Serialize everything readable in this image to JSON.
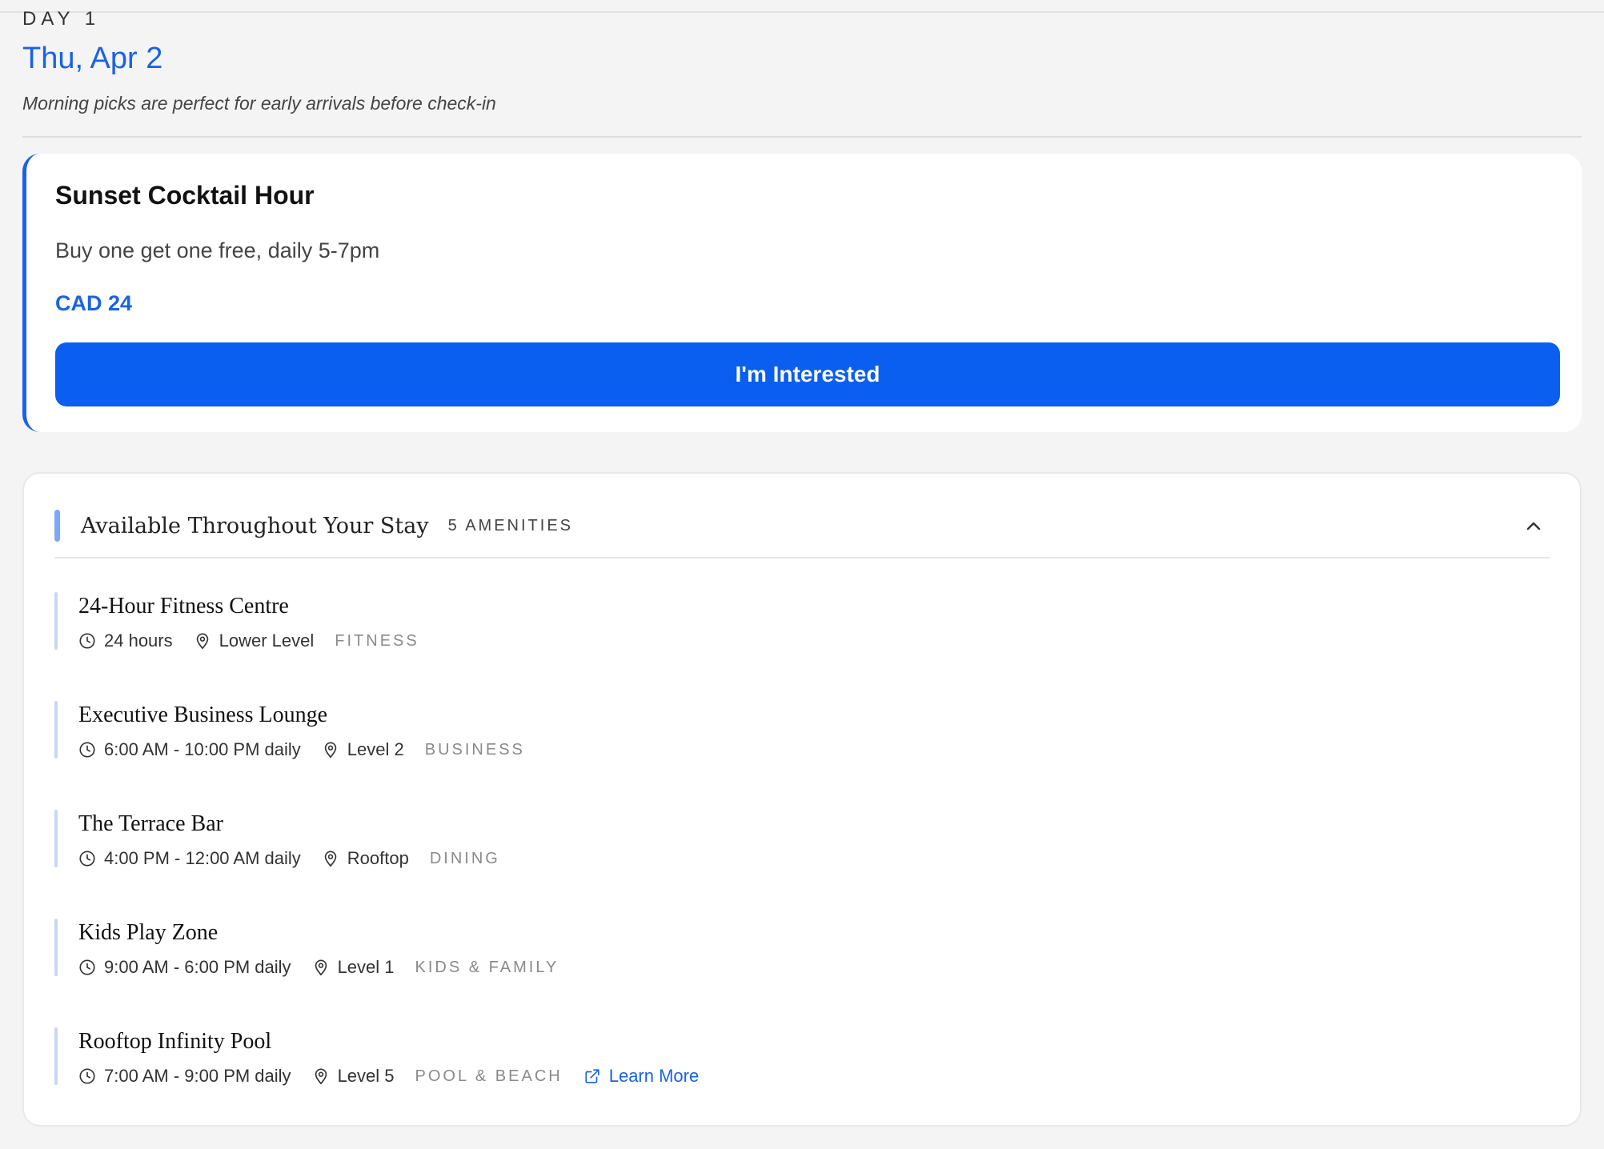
{
  "day": {
    "label": "DAY 1",
    "date": "Thu, Apr 2",
    "note": "Morning picks are perfect for early arrivals before check-in"
  },
  "offer": {
    "title": "Sunset Cocktail Hour",
    "description": "Buy one get one free, daily 5-7pm",
    "price": "CAD 24",
    "button_label": "I'm Interested"
  },
  "amenities": {
    "title": "Available Throughout Your Stay",
    "count_label": "5 AMENITIES",
    "collapse_icon": "chevron-up-icon",
    "items": [
      {
        "name": "24-Hour Fitness Centre",
        "hours": "24 hours",
        "location": "Lower Level",
        "category": "FITNESS"
      },
      {
        "name": "Executive Business Lounge",
        "hours": "6:00 AM - 10:00 PM daily",
        "location": "Level 2",
        "category": "BUSINESS"
      },
      {
        "name": "The Terrace Bar",
        "hours": "4:00 PM - 12:00 AM daily",
        "location": "Rooftop",
        "category": "DINING"
      },
      {
        "name": "Kids Play Zone",
        "hours": "9:00 AM - 6:00 PM daily",
        "location": "Level 1",
        "category": "KIDS & FAMILY"
      },
      {
        "name": "Rooftop Infinity Pool",
        "hours": "7:00 AM - 9:00 PM daily",
        "location": "Level 5",
        "category": "POOL & BEACH",
        "link_label": "Learn More"
      }
    ]
  },
  "colors": {
    "accent": "#1a62e6",
    "button": "#0a5ef0",
    "category_text": "#8a8a8a"
  }
}
